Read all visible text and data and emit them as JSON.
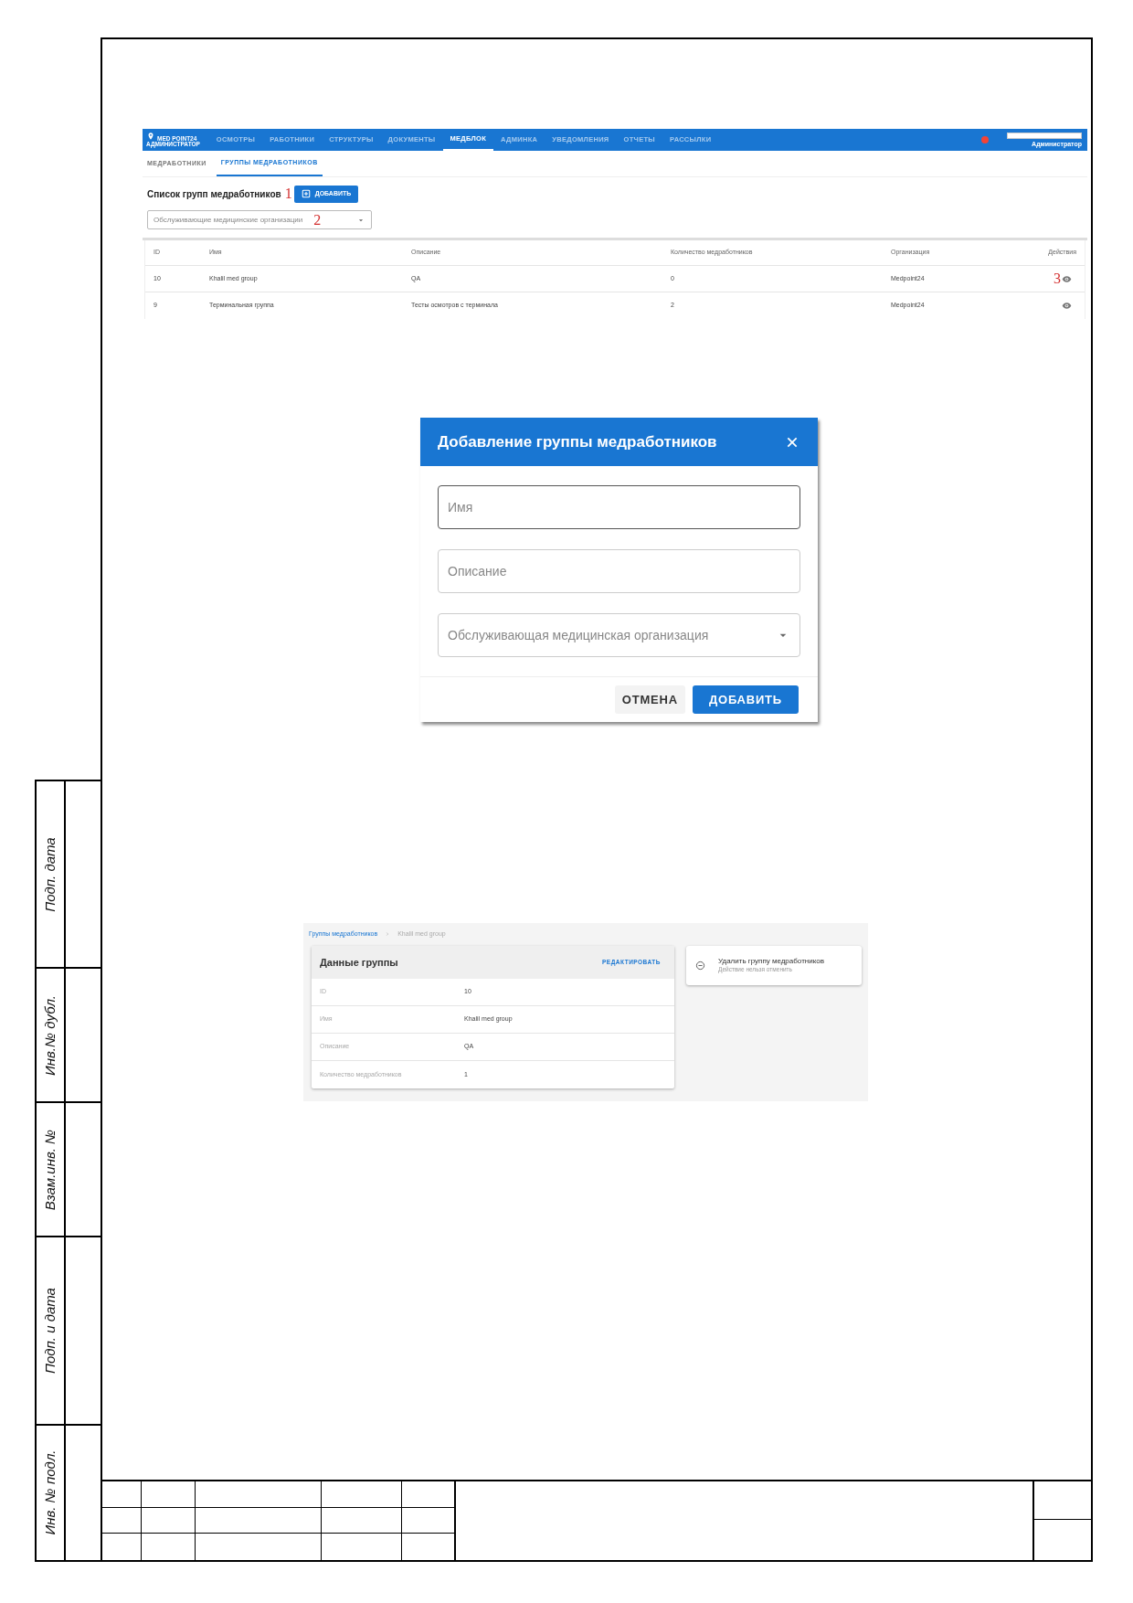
{
  "app_screen": {
    "logo": {
      "brand": "MED POINT24",
      "role": "АДМИНИСТРАТОР"
    },
    "nav": [
      {
        "label": "ОСМОТРЫ",
        "selected": false
      },
      {
        "label": "РАБОТНИКИ",
        "selected": false
      },
      {
        "label": "СТРУКТУРЫ",
        "selected": false
      },
      {
        "label": "ДОКУМЕНТЫ",
        "selected": false
      },
      {
        "label": "МЕДБЛОК",
        "selected": true
      },
      {
        "label": "АДМИНКА",
        "selected": false
      },
      {
        "label": "УВЕДОМЛЕНИЯ",
        "selected": false
      },
      {
        "label": "ОТЧЕТЫ",
        "selected": false
      },
      {
        "label": "РАССЫЛКИ",
        "selected": false
      }
    ],
    "user": {
      "name": "Администратор",
      "notification": true
    },
    "subtabs": [
      {
        "label": "МЕДРАБОТНИКИ",
        "selected": false
      },
      {
        "label": "ГРУППЫ МЕДРАБОТНИКОВ",
        "selected": true
      }
    ],
    "title": "Список групп медработников",
    "title_marker": "1",
    "add_button": "ДОБАВИТЬ",
    "filter": {
      "placeholder": "Обслуживающие медицинские организации",
      "marker": "2"
    },
    "table": {
      "columns": [
        "ID",
        "Имя",
        "Описание",
        "Количество медработников",
        "Организация",
        "Действия"
      ],
      "rows": [
        {
          "cells": [
            "10",
            "Khalil med group",
            "QA",
            "0",
            "Medpoint24"
          ],
          "marker": "3"
        },
        {
          "cells": [
            "9",
            "Терминальная группа",
            "Тесты осмотров с терминала",
            "2",
            "Medpoint24"
          ]
        }
      ]
    }
  },
  "dialog": {
    "title": "Добавление группы медработников",
    "fields": [
      {
        "kind": "text",
        "placeholder": "Имя",
        "focused": true
      },
      {
        "kind": "text",
        "placeholder": "Описание",
        "focused": false
      },
      {
        "kind": "select",
        "placeholder": "Обслуживающая медицинская организация",
        "focused": false
      }
    ],
    "buttons": [
      {
        "label": "ОТМЕНА",
        "kind": "text"
      },
      {
        "label": "ДОБАВИТЬ",
        "kind": "primary"
      }
    ]
  },
  "detail_screen": {
    "breadcrumb": [
      {
        "label": "Группы медработников",
        "kind": "link"
      },
      {
        "label": "Khalil med group",
        "kind": "current"
      }
    ],
    "card": {
      "title": "Данные группы",
      "edit_button": "РЕДАКТИРОВАТЬ",
      "rows": [
        {
          "label": "ID",
          "value": "10"
        },
        {
          "label": "Имя",
          "value": "Khalil med group"
        },
        {
          "label": "Описание",
          "value": "QA"
        },
        {
          "label": "Количество медработников",
          "value": "1"
        }
      ]
    },
    "delete_card": {
      "title": "Удалить группу медработников",
      "subtitle": "Действие нельзя отменить"
    }
  },
  "stamp_labels": [
    "Подп. дата",
    "Инв.№ дубл.",
    "Взам.инв. №",
    "Подп. и дата",
    "Инв. № подл."
  ]
}
